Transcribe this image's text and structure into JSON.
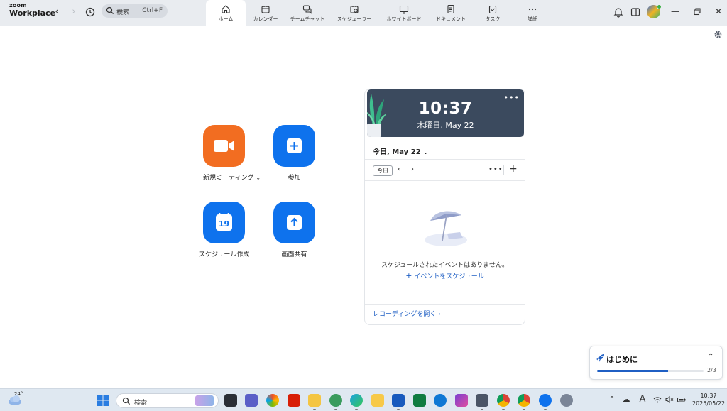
{
  "app": {
    "brand_top": "zoom",
    "brand_bottom": "Workplace"
  },
  "search": {
    "label": "検索",
    "shortcut": "Ctrl+F"
  },
  "tabs": [
    {
      "label": "ホーム",
      "icon": "home-icon",
      "active": true
    },
    {
      "label": "カレンダー",
      "icon": "calendar-icon"
    },
    {
      "label": "チームチャット",
      "icon": "chat-icon"
    },
    {
      "label": "スケジューラー",
      "icon": "scheduler-icon"
    },
    {
      "label": "ホワイトボード",
      "icon": "whiteboard-icon"
    },
    {
      "label": "ドキュメント",
      "icon": "document-icon"
    },
    {
      "label": "タスク",
      "icon": "task-icon"
    },
    {
      "label": "詳細",
      "icon": "more-icon"
    }
  ],
  "actions": {
    "new_meeting": "新規ミーティング",
    "join": "参加",
    "schedule": "スケジュール作成",
    "schedule_day": "19",
    "share_screen": "画面共有"
  },
  "colors": {
    "orange": "#f26d21",
    "blue": "#0e72ed",
    "link": "#1f5fc4",
    "card_header": "#3b4a5e"
  },
  "calendar": {
    "time": "10:37",
    "date_full": "木曜日, May 22",
    "date_short": "今日, May 22",
    "today_button": "今日",
    "empty_text": "スケジュールされたイベントはありません。",
    "add_event": "イベントをスケジュール",
    "recordings_link": "レコーディングを開く"
  },
  "getting_started": {
    "title": "はじめに",
    "count": "2/3",
    "progress": 0.667
  },
  "taskbar": {
    "temperature": "24°",
    "search_label": "検索",
    "time": "10:37",
    "date": "2025/05/22",
    "ime": "A"
  }
}
